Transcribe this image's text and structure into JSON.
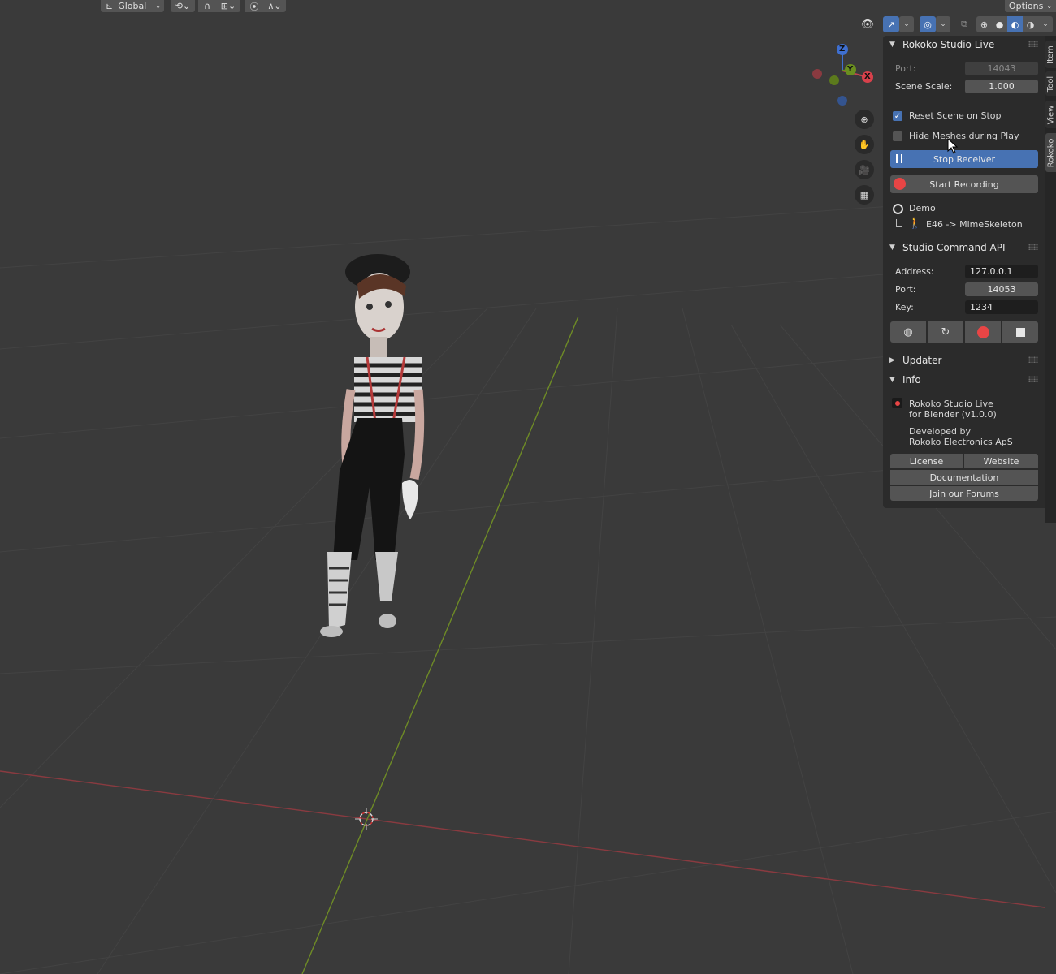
{
  "header": {
    "transform_orientation": "Global",
    "options_label": "Options"
  },
  "colors": {
    "accent": "#4772b3",
    "record": "#e84545",
    "x_axis": "#c0454f",
    "y_axis": "#6a8f1f",
    "z_axis": "#3e6fd0"
  },
  "gizmo": {
    "x_label": "X",
    "y_label": "Y",
    "z_label": "Z"
  },
  "tabs": [
    {
      "label": "Item"
    },
    {
      "label": "Tool"
    },
    {
      "label": "View"
    },
    {
      "label": "Rokoko"
    }
  ],
  "studio_live": {
    "title": "Rokoko Studio Live",
    "port_label": "Port:",
    "port_value": "14043",
    "scale_label": "Scene Scale:",
    "scale_value": "1.000",
    "reset_label": "Reset Scene on Stop",
    "reset_checked": true,
    "hide_label": "Hide Meshes during Play",
    "hide_checked": false,
    "stop_receiver_label": "Stop Receiver",
    "start_recording_label": "Start Recording",
    "demo_label": "Demo",
    "mapping_label": "E46  -> MimeSkeleton"
  },
  "command_api": {
    "title": "Studio Command API",
    "address_label": "Address:",
    "address_value": "127.0.0.1",
    "port_label": "Port:",
    "port_value": "14053",
    "key_label": "Key:",
    "key_value": "1234"
  },
  "updater": {
    "title": "Updater"
  },
  "info": {
    "title": "Info",
    "line1": "Rokoko Studio Live",
    "line2": "for Blender (v1.0.0)",
    "line3": "Developed by",
    "line4": "Rokoko Electronics ApS",
    "license_label": "License",
    "website_label": "Website",
    "documentation_label": "Documentation",
    "forums_label": "Join our Forums"
  }
}
